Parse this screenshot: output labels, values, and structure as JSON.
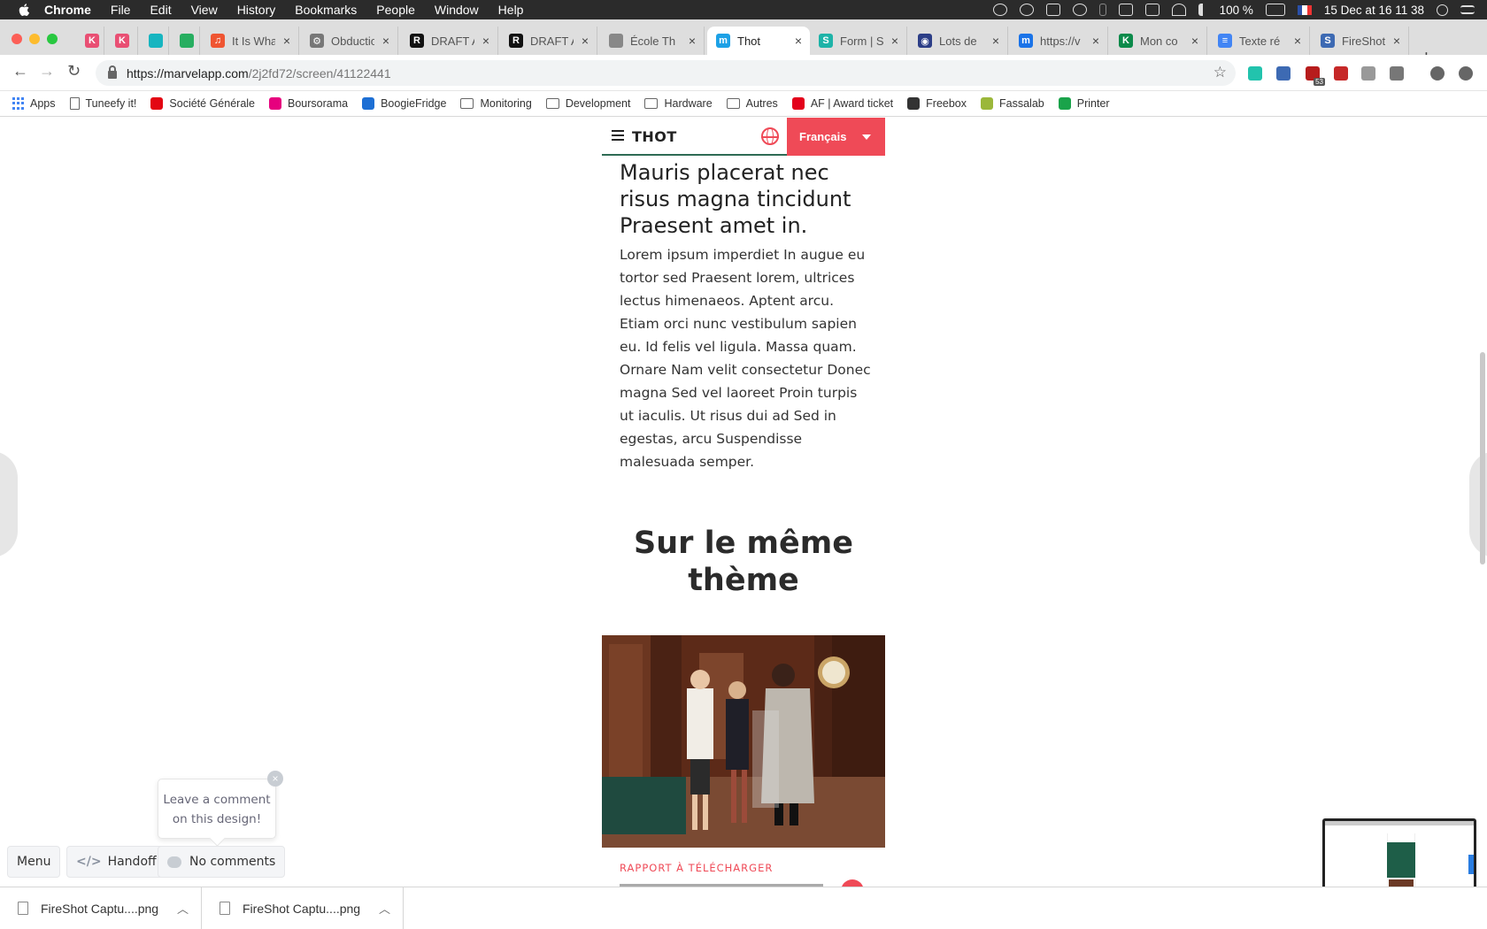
{
  "menubar": {
    "app_name": "Chrome",
    "items": [
      "File",
      "Edit",
      "View",
      "History",
      "Bookmarks",
      "People",
      "Window",
      "Help"
    ],
    "battery": "100 %",
    "datetime": "15 Dec at  16 11 38"
  },
  "tabs": [
    {
      "label": "",
      "color": "#e94f73",
      "icon": "kanbanize-icon",
      "glyph": "K"
    },
    {
      "label": "",
      "color": "#e94f73",
      "icon": "kanbanize-icon",
      "glyph": "K"
    },
    {
      "label": "",
      "color": "#17b5c0",
      "icon": "trello-icon",
      "glyph": ""
    },
    {
      "label": "",
      "color": "#27ae60",
      "icon": "trello-icon",
      "glyph": ""
    },
    {
      "label": "It Is Wha",
      "color": "#ef5532",
      "icon": "soundcloud-icon",
      "glyph": "♫"
    },
    {
      "label": "Obductio",
      "color": "#777777",
      "icon": "gear-icon",
      "glyph": "⚙"
    },
    {
      "label": "DRAFT A",
      "color": "#111111",
      "icon": "r-logo-icon",
      "glyph": "R"
    },
    {
      "label": "DRAFT A",
      "color": "#111111",
      "icon": "r-logo-icon",
      "glyph": "R"
    },
    {
      "label": "École Th",
      "color": "#888888",
      "icon": "document-icon",
      "glyph": ""
    },
    {
      "label": "Thot",
      "color": "#1da1e6",
      "icon": "marvel-icon",
      "glyph": "m",
      "active": true
    },
    {
      "label": "Form | S",
      "color": "#1eb3a8",
      "icon": "s-logo-icon",
      "glyph": "S"
    },
    {
      "label": "Lots de",
      "color": "#2c3e87",
      "icon": "eye-icon",
      "glyph": "◉"
    },
    {
      "label": "https://v",
      "color": "#1a73e8",
      "icon": "m-logo-icon",
      "glyph": "m"
    },
    {
      "label": "Mon co",
      "color": "#0b8a4a",
      "icon": "k-logo-icon",
      "glyph": "K"
    },
    {
      "label": "Texte ré",
      "color": "#4285f4",
      "icon": "docs-icon",
      "glyph": "≡"
    },
    {
      "label": "FireShot",
      "color": "#3d6ab3",
      "icon": "fireshot-icon",
      "glyph": "S"
    }
  ],
  "address": {
    "host": "https://marvelapp.com",
    "path": "/2j2fd72/screen/41122441"
  },
  "extensions": [
    {
      "name": "marvel-ext-icon",
      "color": "#22c3ad"
    },
    {
      "name": "fireshot-ext-icon",
      "color": "#3d6ab3"
    },
    {
      "name": "badge-ext-icon",
      "color": "#b71c1c",
      "badge": "53"
    },
    {
      "name": "shield-ext-icon",
      "color": "#c62828"
    },
    {
      "name": "json-ext-icon",
      "color": "#999999"
    },
    {
      "name": "s-ext-icon",
      "color": "#777777"
    },
    {
      "name": "profile-icon",
      "color": "#666666"
    },
    {
      "name": "update-icon",
      "color": "#666666"
    }
  ],
  "bookmarks": [
    {
      "label": "Apps",
      "icon": "apps-icon"
    },
    {
      "label": "Tuneefy it!",
      "icon": "doc-icon"
    },
    {
      "label": "Société Générale",
      "icon": "socgen-icon"
    },
    {
      "label": "Boursorama",
      "icon": "boursorama-icon"
    },
    {
      "label": "BoogieFridge",
      "icon": "dsm-icon"
    },
    {
      "label": "Monitoring",
      "icon": "folder-icon"
    },
    {
      "label": "Development",
      "icon": "folder-icon"
    },
    {
      "label": "Hardware",
      "icon": "folder-icon"
    },
    {
      "label": "Autres",
      "icon": "folder-icon"
    },
    {
      "label": "AF | Award ticket",
      "icon": "airfrance-icon"
    },
    {
      "label": "Freebox",
      "icon": "freebox-icon"
    },
    {
      "label": "Fassalab",
      "icon": "fassalab-icon"
    },
    {
      "label": "Printer",
      "icon": "printer-icon"
    }
  ],
  "design": {
    "logo": "THOT",
    "language": "Français",
    "article_title": "Mauris placerat nec risus magna tincidunt Praesent amet in.",
    "article_body": "Lorem ipsum imperdiet In augue eu tortor sed Praesent lorem, ultrices lectus himenaeos. Aptent arcu. Etiam orci nunc vestibulum sapien eu. Id felis vel ligula. Massa quam. Ornare Nam velit consectetur Donec magna Sed vel laoreet Proin turpis ut iaculis. Ut risus dui ad Sed in egestas, arcu Suspendisse malesuada semper.",
    "related_heading": "Sur le même thème",
    "card_tag": "RAPPORT À TÉLÉCHARGER",
    "accent": "#ef4a57",
    "header_border": "#2e6b54"
  },
  "marvel": {
    "comment_prompt": "Leave a comment on this design!",
    "close": "×",
    "menu": "Menu",
    "handoff": "Handoff",
    "comments": "No comments"
  },
  "downloads": [
    {
      "name": "FireShot Captu....png"
    },
    {
      "name": "FireShot Captu....png"
    }
  ]
}
